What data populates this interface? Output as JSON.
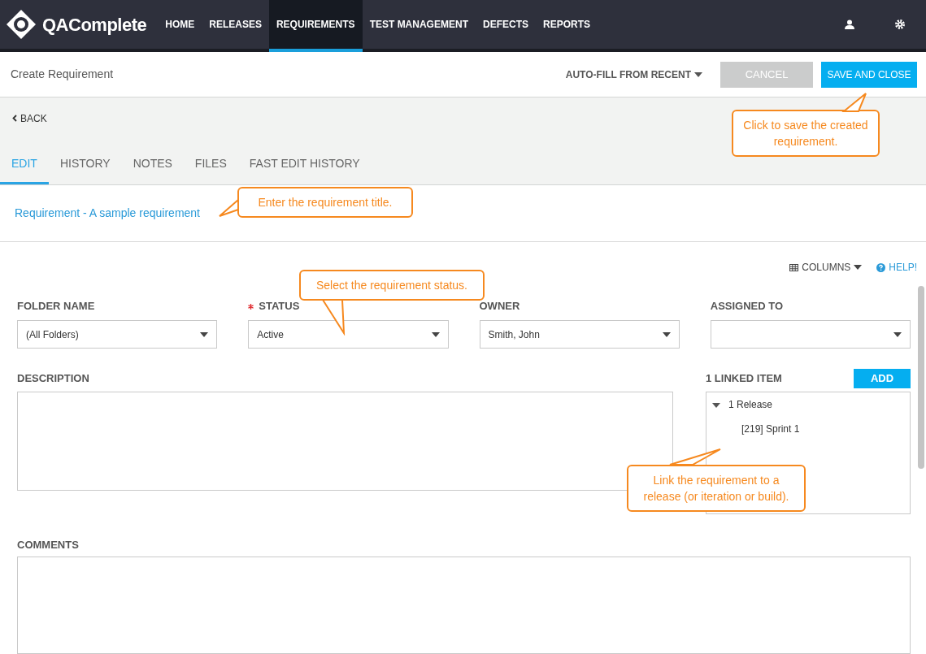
{
  "app": {
    "logo_text": "QAComplete"
  },
  "nav": [
    {
      "label": "HOME",
      "selected": false
    },
    {
      "label": "RELEASES",
      "selected": false
    },
    {
      "label": "REQUIREMENTS",
      "selected": true
    },
    {
      "label": "TEST MANAGEMENT",
      "selected": false
    },
    {
      "label": "DEFECTS",
      "selected": false
    },
    {
      "label": "REPORTS",
      "selected": false
    }
  ],
  "header": {
    "title": "Create Requirement",
    "autofill": "AUTO-FILL FROM RECENT",
    "cancel": {
      "label": "CANCEL",
      "disabled": true
    },
    "save": "SAVE AND CLOSE"
  },
  "back": "BACK",
  "tabs": [
    {
      "label": "EDIT",
      "selected": true
    },
    {
      "label": "HISTORY",
      "selected": false
    },
    {
      "label": "NOTES",
      "selected": false
    },
    {
      "label": "FILES",
      "selected": false
    },
    {
      "label": "FAST EDIT HISTORY",
      "selected": false
    }
  ],
  "record_title": "Requirement - A sample requirement",
  "toolbar": {
    "columns": "COLUMNS",
    "help": "HELP!"
  },
  "fields": [
    {
      "label": "FOLDER NAME",
      "value": "(All Folders)",
      "required": false
    },
    {
      "label": "STATUS",
      "value": "Active",
      "required": true
    },
    {
      "label": "OWNER",
      "value": "Smith, John",
      "required": false
    },
    {
      "label": "ASSIGNED TO",
      "required": false
    }
  ],
  "description": {
    "label": "DESCRIPTION"
  },
  "linked": {
    "label": "1 LINKED ITEM",
    "add": "ADD",
    "tree": [
      {
        "label": "1 Release",
        "expanded": true,
        "children": [
          {
            "label": "[219] Sprint 1"
          }
        ]
      }
    ]
  },
  "comments": {
    "label": "COMMENTS"
  },
  "callouts": {
    "save": "Click to save the created requirement.",
    "title": "Enter the requirement title.",
    "status": "Select the requirement status.",
    "link": "Link the requirement to a release (or iteration or build)."
  }
}
